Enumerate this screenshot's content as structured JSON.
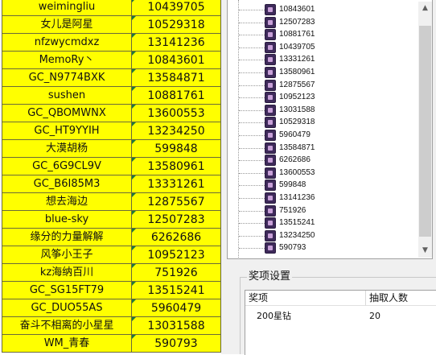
{
  "sheet": {
    "rows": [
      {
        "name": "weimingliu",
        "id": "10439705"
      },
      {
        "name": "女儿是阿星",
        "id": "10529318"
      },
      {
        "name": "nfzwycmdxz",
        "id": "13141236"
      },
      {
        "name": "MemoRy丶",
        "id": "10843601"
      },
      {
        "name": "GC_N9774BXK",
        "id": "13584871"
      },
      {
        "name": "sushen",
        "id": "10881761"
      },
      {
        "name": "GC_QBOMWNX",
        "id": "13600553"
      },
      {
        "name": "GC_HT9YYIH",
        "id": "13234250"
      },
      {
        "name": "大漠胡杨",
        "id": "599848"
      },
      {
        "name": "GC_6G9CL9V",
        "id": "13580961"
      },
      {
        "name": "GC_B6I85M3",
        "id": "13331261"
      },
      {
        "name": "想去海边",
        "id": "12875567"
      },
      {
        "name": "blue-sky",
        "id": "12507283"
      },
      {
        "name": "缘分的力量解解",
        "id": "6262686"
      },
      {
        "name": "风筝小王子",
        "id": "10952123"
      },
      {
        "name": "kz海纳百川",
        "id": "751926"
      },
      {
        "name": "GC_SG15FT79",
        "id": "13515241"
      },
      {
        "name": "GC_DUO55AS",
        "id": "5960479"
      },
      {
        "name": "奋斗不相离的小星星",
        "id": "13031588"
      },
      {
        "name": "WM_青春",
        "id": "590793"
      }
    ],
    "cell_color": "#ffff00"
  },
  "tree": {
    "icon": "user-node-icon",
    "items": [
      "10843601",
      "12507283",
      "10881761",
      "10439705",
      "13331261",
      "13580961",
      "12875567",
      "10952123",
      "13031588",
      "10529318",
      "5960479",
      "13584871",
      "6262686",
      "13600553",
      "599848",
      "13141236",
      "751926",
      "13515241",
      "13234250",
      "590793"
    ]
  },
  "prize": {
    "title": "奖项设置",
    "col_item": "奖项",
    "col_count": "抽取人数",
    "rows": [
      {
        "item": "200星钻",
        "count": "20"
      }
    ]
  }
}
